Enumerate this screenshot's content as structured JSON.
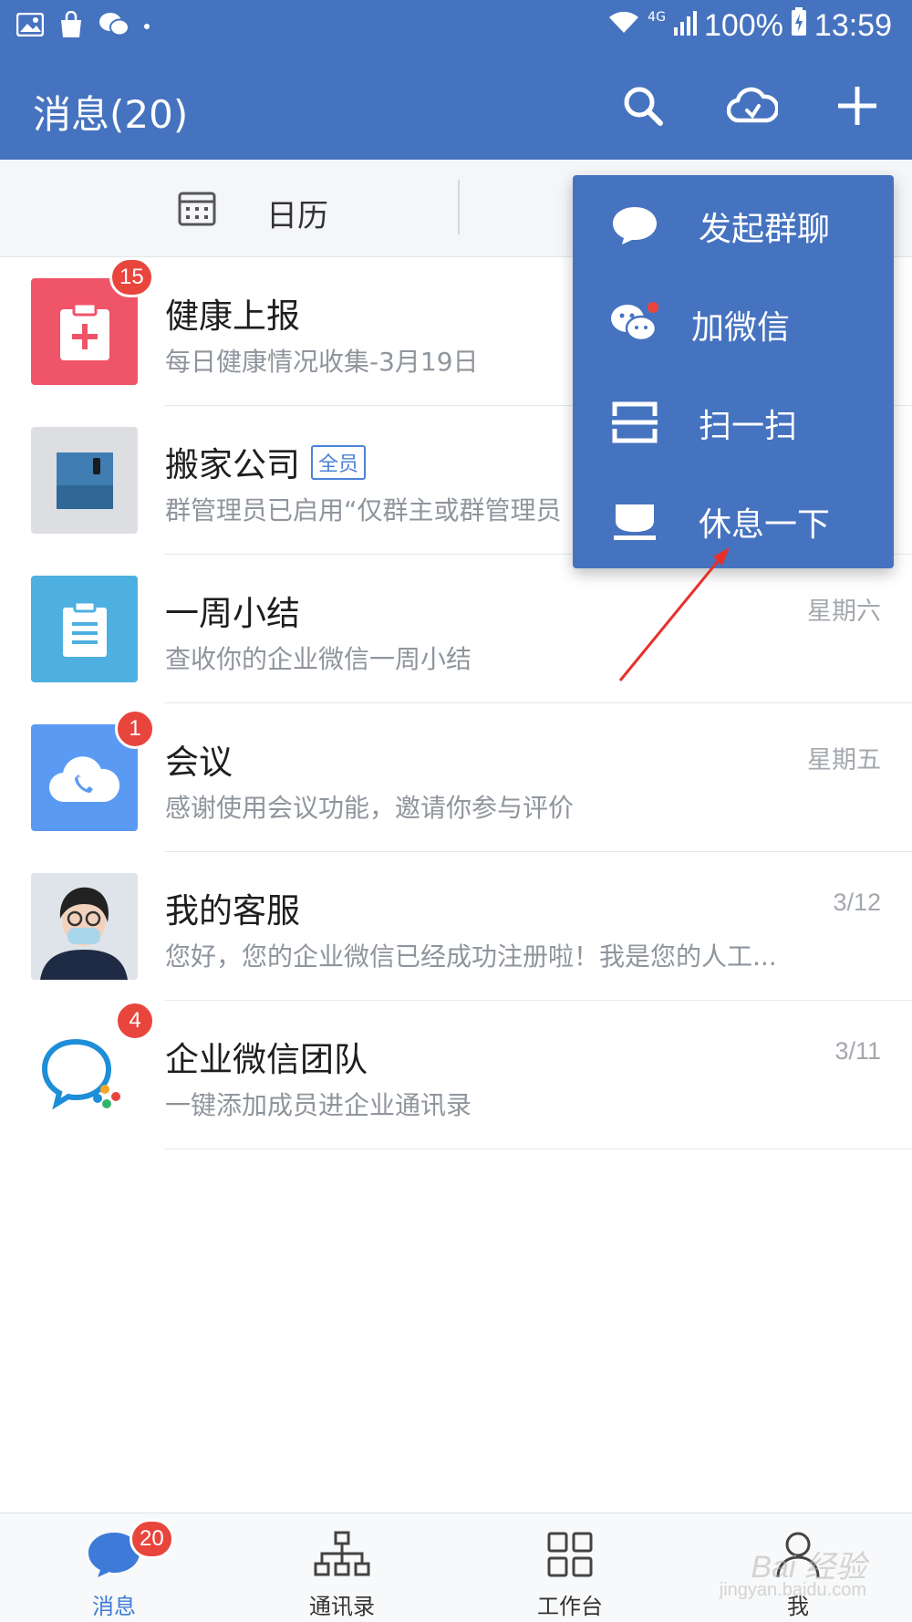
{
  "status_bar": {
    "network": "4G",
    "battery": "100%",
    "time": "13:59"
  },
  "header": {
    "title": "消息(20)",
    "actions": [
      "search-icon",
      "cloud-icon",
      "plus-icon"
    ]
  },
  "quick_bar": {
    "calendar_label": "日历"
  },
  "popup_menu": {
    "items": [
      {
        "label": "发起群聊",
        "icon": "chat-bubble-icon"
      },
      {
        "label": "加微信",
        "icon": "wechat-icon"
      },
      {
        "label": "扫一扫",
        "icon": "scan-icon"
      },
      {
        "label": "休息一下",
        "icon": "rest-icon"
      }
    ]
  },
  "chats": [
    {
      "name": "健康上报",
      "preview": "每日健康情况收集-3月19日",
      "time": "",
      "badge": "15",
      "avatar_color": "#f05468"
    },
    {
      "name": "搬家公司",
      "tag": "全员",
      "preview": "群管理员已启用“仅群主或群管理员",
      "time": "",
      "badge": "",
      "avatar_color": "#dcdee2"
    },
    {
      "name": "一周小结",
      "preview": "查收你的企业微信一周小结",
      "time": "星期六",
      "badge": "",
      "avatar_color": "#4db0e0"
    },
    {
      "name": "会议",
      "preview": "感谢使用会议功能，邀请你参与评价",
      "time": "星期五",
      "badge": "1",
      "avatar_color": "#5a9af2"
    },
    {
      "name": "我的客服",
      "preview": "您好，您的企业微信已经成功注册啦！我是您的人工...",
      "time": "3/12",
      "badge": "",
      "avatar_color": "#d8dde3"
    },
    {
      "name": "企业微信团队",
      "preview": "一键添加成员进企业通讯录",
      "time": "3/11",
      "badge": "4",
      "avatar_color": "#ffffff"
    }
  ],
  "bottom_nav": {
    "tabs": [
      {
        "label": "消息",
        "badge": "20",
        "active": true
      },
      {
        "label": "通讯录"
      },
      {
        "label": "工作台"
      },
      {
        "label": "我"
      }
    ]
  },
  "watermark": {
    "main": "Bai 经验",
    "sub": "jingyan.baidu.com"
  }
}
